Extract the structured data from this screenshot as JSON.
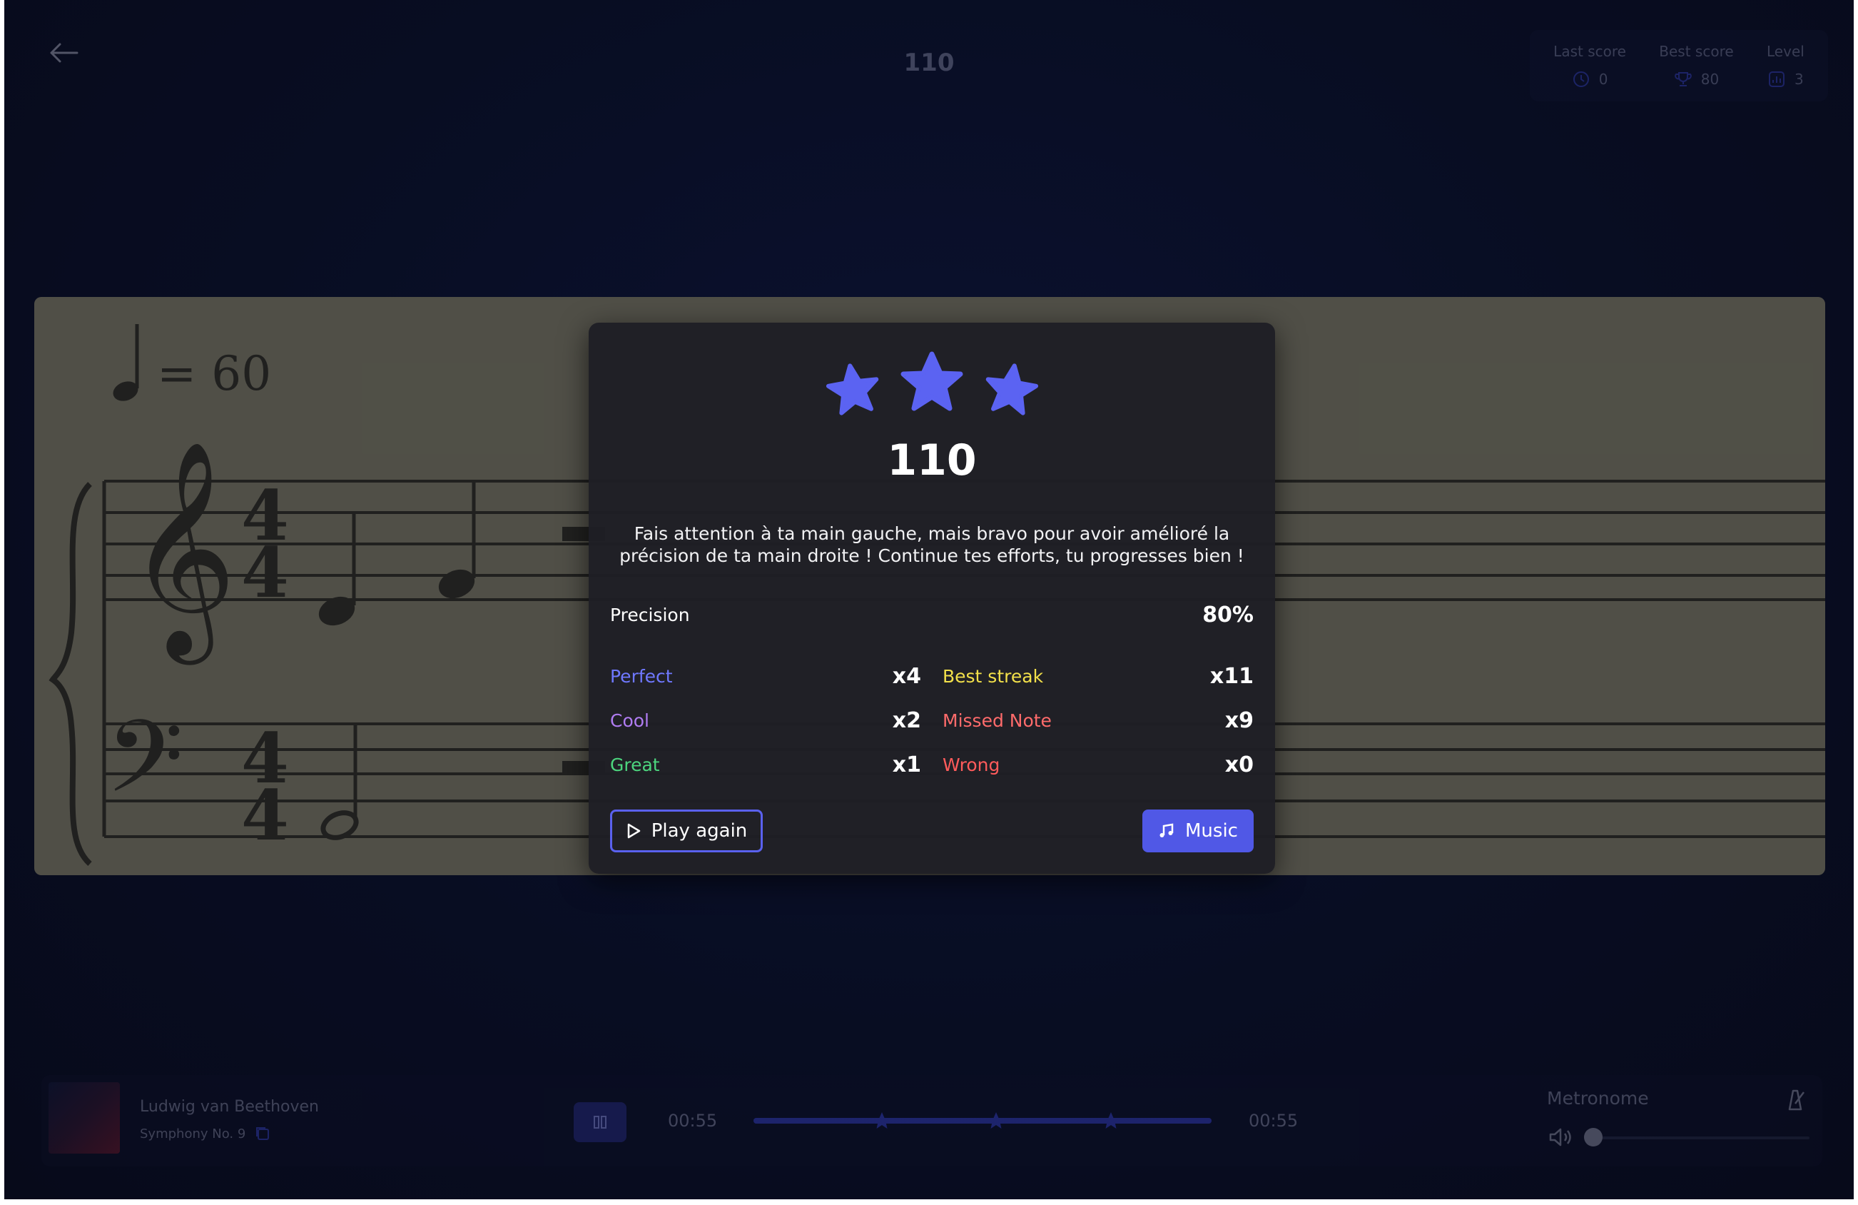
{
  "header": {
    "score": "110",
    "stats": [
      {
        "label": "Last score",
        "value": "0",
        "icon": "clock-icon"
      },
      {
        "label": "Best score",
        "value": "80",
        "icon": "trophy-icon"
      },
      {
        "label": "Level",
        "value": "3",
        "icon": "level-icon"
      }
    ]
  },
  "sheet": {
    "tempo_value": "= 60",
    "time_signature_top": "4",
    "time_signature_bottom": "4"
  },
  "modal": {
    "stars_earned": 3,
    "score": "110",
    "feedback": "Fais attention à ta main gauche, mais bravo pour avoir amélioré la précision de ta main droite ! Continue tes efforts, tu progresses bien !",
    "precision_label": "Precision",
    "precision_value": "80%",
    "left_stats": [
      {
        "label": "Perfect",
        "count": "x4",
        "color": "#6f78ff"
      },
      {
        "label": "Cool",
        "count": "x2",
        "color": "#b07cf2"
      },
      {
        "label": "Great",
        "count": "x1",
        "color": "#4cd57e"
      }
    ],
    "right_stats": [
      {
        "label": "Best streak",
        "count": "x11",
        "color": "#f2e04a"
      },
      {
        "label": "Missed Note",
        "count": "x9",
        "color": "#ff6b6b"
      },
      {
        "label": "Wrong",
        "count": "x0",
        "color": "#ff5b5b"
      }
    ],
    "play_again_label": "Play again",
    "music_label": "Music"
  },
  "player": {
    "composer": "Ludwig van Beethoven",
    "piece": "Symphony No. 9",
    "time_elapsed": "00:55",
    "time_total": "00:55",
    "progress": 1.0,
    "star_markers": [
      0.28,
      0.53,
      0.78
    ],
    "metronome_label": "Metronome",
    "metronome_volume": 0.0
  }
}
